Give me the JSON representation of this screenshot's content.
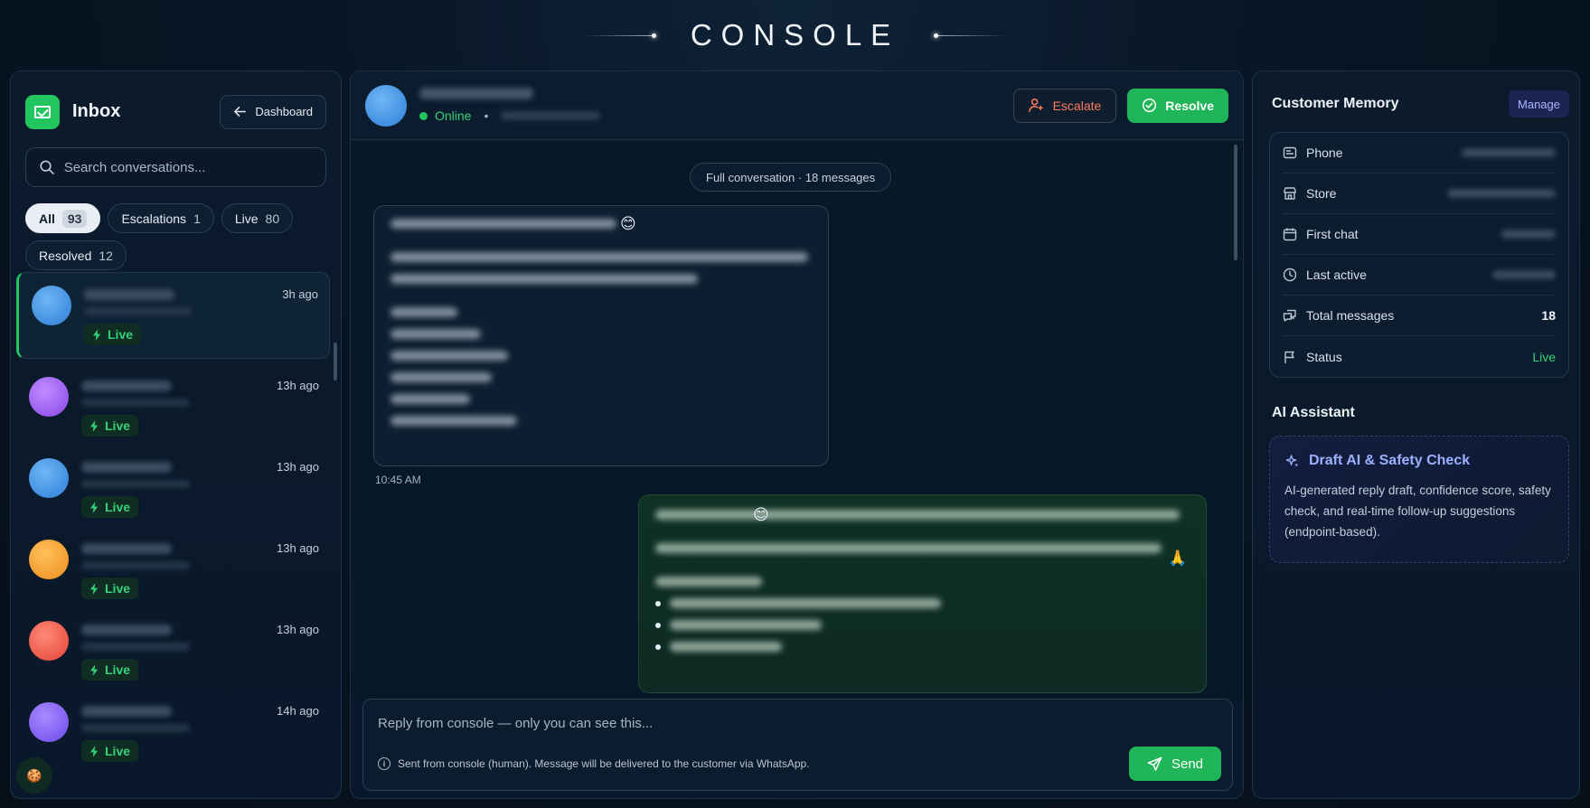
{
  "header": {
    "title": "CONSOLE"
  },
  "inbox": {
    "title": "Inbox",
    "dashboard_label": "Dashboard",
    "search_placeholder": "Search conversations...",
    "filters": [
      {
        "label": "All",
        "count": "93"
      },
      {
        "label": "Escalations",
        "count": "1"
      },
      {
        "label": "Live",
        "count": "80"
      },
      {
        "label": "Resolved",
        "count": "12"
      }
    ],
    "conversations": [
      {
        "time": "3h ago",
        "status": "Live",
        "color": "#3b8fe8"
      },
      {
        "time": "13h ago",
        "status": "Live",
        "color": "#9b5cf0"
      },
      {
        "time": "13h ago",
        "status": "Live",
        "color": "#3b8fe8"
      },
      {
        "time": "13h ago",
        "status": "Live",
        "color": "#f29c2b"
      },
      {
        "time": "13h ago",
        "status": "Live",
        "color": "#ef5544"
      },
      {
        "time": "14h ago",
        "status": "Live",
        "color": "#7b5cf0"
      }
    ]
  },
  "chat": {
    "status": "Online",
    "separator": "•",
    "escalate_label": "Escalate",
    "resolve_label": "Resolve",
    "conversation_pill": "Full conversation · 18 messages",
    "message_time": "10:45 AM",
    "composer_placeholder": "Reply from console — only you can see this...",
    "composer_note": "Sent from console (human). Message will be delivered to the customer via WhatsApp.",
    "send_label": "Send"
  },
  "memory": {
    "title": "Customer Memory",
    "manage_label": "Manage",
    "rows": [
      {
        "label": "Phone",
        "icon": "phone-icon"
      },
      {
        "label": "Store",
        "icon": "store-icon"
      },
      {
        "label": "First chat",
        "icon": "calendar-icon"
      },
      {
        "label": "Last active",
        "icon": "clock-icon"
      },
      {
        "label": "Total messages",
        "value": "18",
        "icon": "messages-icon"
      },
      {
        "label": "Status",
        "value": "Live",
        "icon": "flag-icon"
      }
    ]
  },
  "assistant": {
    "title": "AI Assistant",
    "card_title": "Draft AI & Safety Check",
    "card_description": "AI-generated reply draft, confidence score, safety check, and real-time follow-up suggestions (endpoint-based)."
  },
  "colors": {
    "accent_green": "#22c55e",
    "escalate_red": "#ff7a5c",
    "ai_purple": "#9bb1ff"
  }
}
